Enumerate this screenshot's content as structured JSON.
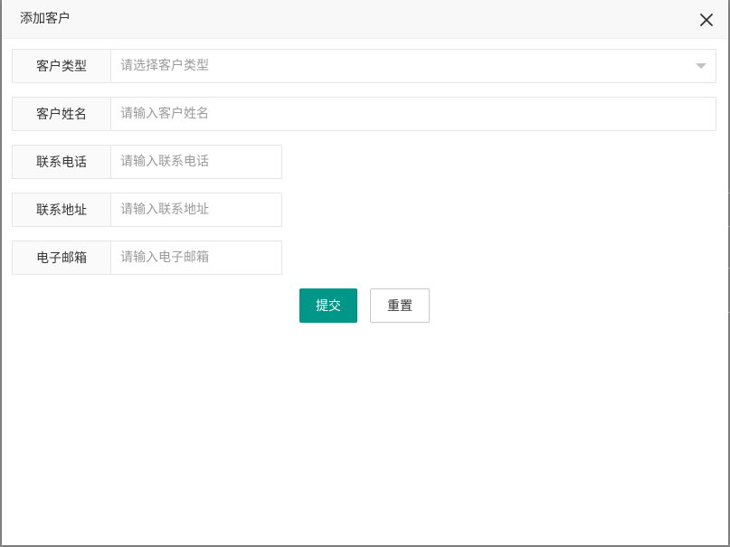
{
  "dialog": {
    "title": "添加客户",
    "close_icon": "close-icon"
  },
  "form": {
    "customer_type": {
      "label": "客户类型",
      "placeholder": "请选择客户类型",
      "value": ""
    },
    "customer_name": {
      "label": "客户姓名",
      "placeholder": "请输入客户姓名",
      "value": ""
    },
    "phone": {
      "label": "联系电话",
      "placeholder": "请输入联系电话",
      "value": ""
    },
    "address": {
      "label": "联系地址",
      "placeholder": "请输入联系地址",
      "value": ""
    },
    "email": {
      "label": "电子邮箱",
      "placeholder": "请输入电子邮箱",
      "value": ""
    }
  },
  "actions": {
    "submit_label": "提交",
    "reset_label": "重置"
  },
  "colors": {
    "primary": "#009688",
    "header_bg": "#f8f8f8",
    "border": "#e6e6e6"
  }
}
